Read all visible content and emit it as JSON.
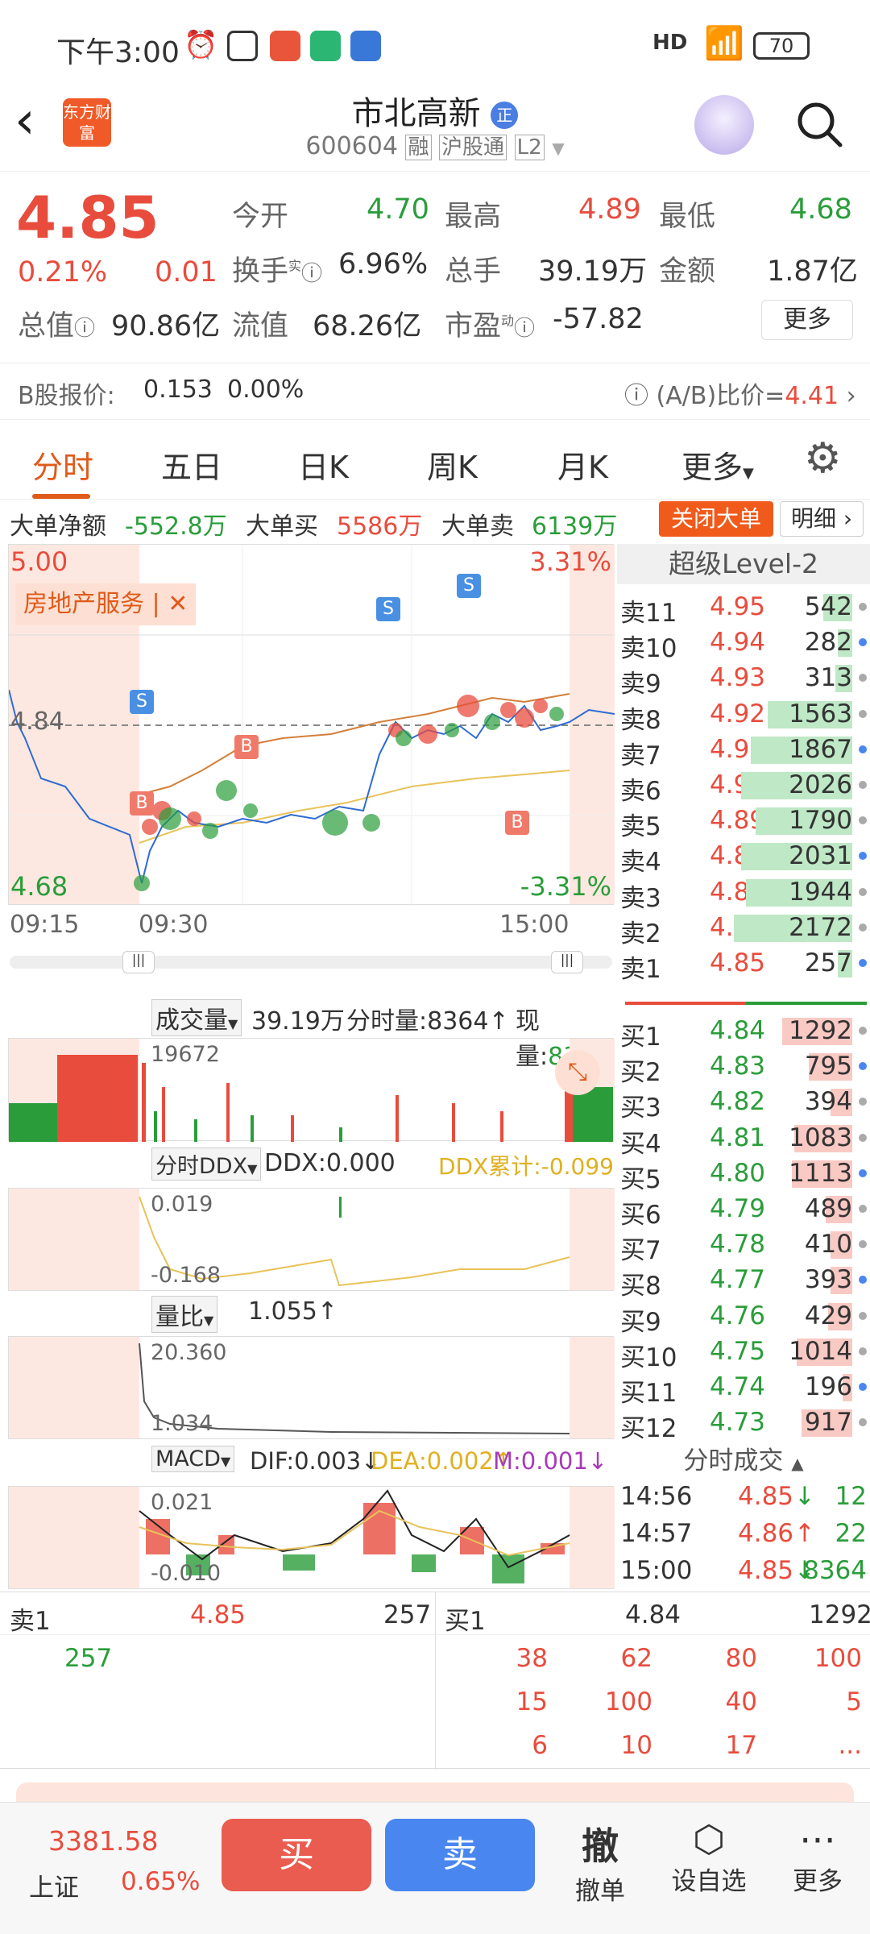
{
  "status": {
    "time": "下午3:00",
    "battery": "70",
    "network": "HD"
  },
  "header": {
    "stock_name": "市北高新",
    "badge": "正",
    "stock_code": "600604",
    "tag_margin": "融",
    "tag_connect": "沪股通",
    "tag_level": "L2",
    "logo_text": "东方财富"
  },
  "quote": {
    "price": "4.85",
    "change_pct": "0.21%",
    "change": "0.01",
    "open_label": "今开",
    "open": "4.70",
    "high_label": "最高",
    "high": "4.89",
    "low_label": "最低",
    "low": "4.68",
    "turnover_label": "换手",
    "turnover_sup": "实",
    "turnover": "6.96%",
    "volume_label": "总手",
    "volume": "39.19万",
    "amount_label": "金额",
    "amount": "1.87亿",
    "mktcap_label": "总值",
    "mktcap": "90.86亿",
    "float_label": "流值",
    "float_cap": "68.26亿",
    "pe_label": "市盈",
    "pe_sup": "动",
    "pe": "-57.82",
    "more": "更多",
    "b_label": "B股报价:",
    "b_price": "0.153",
    "b_pct": "0.00%",
    "ab_label": "(A/B)比价=",
    "ab_value": "4.41"
  },
  "tabs": [
    "分时",
    "五日",
    "日K",
    "周K",
    "月K",
    "更多"
  ],
  "bigorder": {
    "net_label": "大单净额",
    "net": "-552.8万",
    "buy_label": "大单买",
    "buy": "5586万",
    "sell_label": "大单卖",
    "sell": "6139万",
    "close_btn": "关闭大单",
    "detail_btn": "明细"
  },
  "chart": {
    "ymax": "5.00",
    "ymin": "4.68",
    "pct_max": "3.31%",
    "pct_min": "-3.31%",
    "mid": "4.84",
    "sector": "房地产服务",
    "t_start": "09:15",
    "t_mid": "09:30",
    "t_end": "15:00"
  },
  "volume_panel": {
    "label": "成交量",
    "total": "39.19万",
    "tick_label": "分时量:8364",
    "now_label": "现量:",
    "now": "8364",
    "max": "19672"
  },
  "ddx_panel": {
    "label": "分时DDX",
    "ddx": "DDX:0.000",
    "cum": "DDX累计:-0.099",
    "max": "0.019",
    "min": "-0.168"
  },
  "ratio_panel": {
    "label": "量比",
    "value": "1.055",
    "max": "20.360",
    "min": "1.034"
  },
  "macd_panel": {
    "label": "MACD",
    "dif": "DIF:0.003",
    "dea": "DEA:0.002",
    "m": "M:0.001",
    "max": "0.021",
    "min": "-0.010"
  },
  "level2": {
    "title": "超级Level-2",
    "asks": [
      {
        "n": "卖11",
        "p": "4.95",
        "v": "542",
        "w": 0.12
      },
      {
        "n": "卖10",
        "p": "4.94",
        "v": "282",
        "w": 0.06
      },
      {
        "n": "卖9",
        "p": "4.93",
        "v": "313",
        "w": 0.07
      },
      {
        "n": "卖8",
        "p": "4.92",
        "v": "1563",
        "w": 0.35
      },
      {
        "n": "卖7",
        "p": "4.91",
        "v": "1867",
        "w": 0.42
      },
      {
        "n": "卖6",
        "p": "4.90",
        "v": "2026",
        "w": 0.46
      },
      {
        "n": "卖5",
        "p": "4.89",
        "v": "1790",
        "w": 0.4
      },
      {
        "n": "卖4",
        "p": "4.88",
        "v": "2031",
        "w": 0.46
      },
      {
        "n": "卖3",
        "p": "4.87",
        "v": "1944",
        "w": 0.44
      },
      {
        "n": "卖2",
        "p": "4.86",
        "v": "2172",
        "w": 0.49
      },
      {
        "n": "卖1",
        "p": "4.85",
        "v": "257",
        "w": 0.06
      }
    ],
    "bids": [
      {
        "n": "买1",
        "p": "4.84",
        "v": "1292",
        "w": 0.29
      },
      {
        "n": "买2",
        "p": "4.83",
        "v": "795",
        "w": 0.18
      },
      {
        "n": "买3",
        "p": "4.82",
        "v": "394",
        "w": 0.09
      },
      {
        "n": "买4",
        "p": "4.81",
        "v": "1083",
        "w": 0.24
      },
      {
        "n": "买5",
        "p": "4.80",
        "v": "1113",
        "w": 0.25
      },
      {
        "n": "买6",
        "p": "4.79",
        "v": "489",
        "w": 0.11
      },
      {
        "n": "买7",
        "p": "4.78",
        "v": "410",
        "w": 0.09
      },
      {
        "n": "买8",
        "p": "4.77",
        "v": "393",
        "w": 0.09
      },
      {
        "n": "买9",
        "p": "4.76",
        "v": "429",
        "w": 0.1
      },
      {
        "n": "买10",
        "p": "4.75",
        "v": "1014",
        "w": 0.23
      },
      {
        "n": "买11",
        "p": "4.74",
        "v": "196",
        "w": 0.04
      },
      {
        "n": "买12",
        "p": "4.73",
        "v": "917",
        "w": 0.21
      }
    ],
    "trades_title": "分时成交",
    "trades": [
      {
        "t": "14:56",
        "p": "4.85",
        "d": "↓",
        "v": "12"
      },
      {
        "t": "14:57",
        "p": "4.86",
        "d": "↑",
        "v": "22"
      },
      {
        "t": "15:00",
        "p": "4.85",
        "d": "↓",
        "v": "8364"
      }
    ]
  },
  "bottom_book": {
    "sell_label": "卖1",
    "sell_price": "4.85",
    "sell_vol": "257",
    "buy_label": "买1",
    "buy_price": "4.84",
    "buy_vol": "1292",
    "sell_queue": [
      "257"
    ],
    "buy_queue": [
      "38",
      "62",
      "80",
      "100",
      "15",
      "100",
      "40",
      "5",
      "6",
      "10",
      "17",
      "..."
    ]
  },
  "bottombar": {
    "index_value": "3381.58",
    "index_name": "上证",
    "index_pct": "0.65%",
    "buy": "买",
    "sell": "卖",
    "cancel_icon": "撤",
    "cancel": "撤单",
    "watch": "设自选",
    "more": "更多"
  }
}
